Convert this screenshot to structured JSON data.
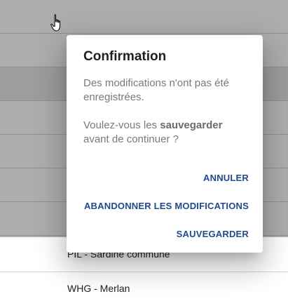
{
  "background_list": {
    "rows": [
      {
        "label": ""
      },
      {
        "label": ""
      },
      {
        "label": ""
      },
      {
        "label": ""
      },
      {
        "label": ""
      },
      {
        "label": ""
      },
      {
        "label": ""
      },
      {
        "label": "PIL - Sardine commune"
      },
      {
        "label": "WHG - Merlan"
      }
    ]
  },
  "dialog": {
    "title": "Confirmation",
    "line1": "Des modifications n'ont pas été enregistrées.",
    "line2_prefix": "Voulez-vous les ",
    "line2_bold": "sauvegarder",
    "line2_suffix": " avant de continuer ?",
    "actions": {
      "cancel": "ANNULER",
      "discard": "ABANDONNER LES MODIFICATIONS",
      "save": "SAUVEGARDER"
    },
    "action_color": "#1f4a8c"
  },
  "cursor": {
    "icon": "hand-pointer-icon"
  }
}
